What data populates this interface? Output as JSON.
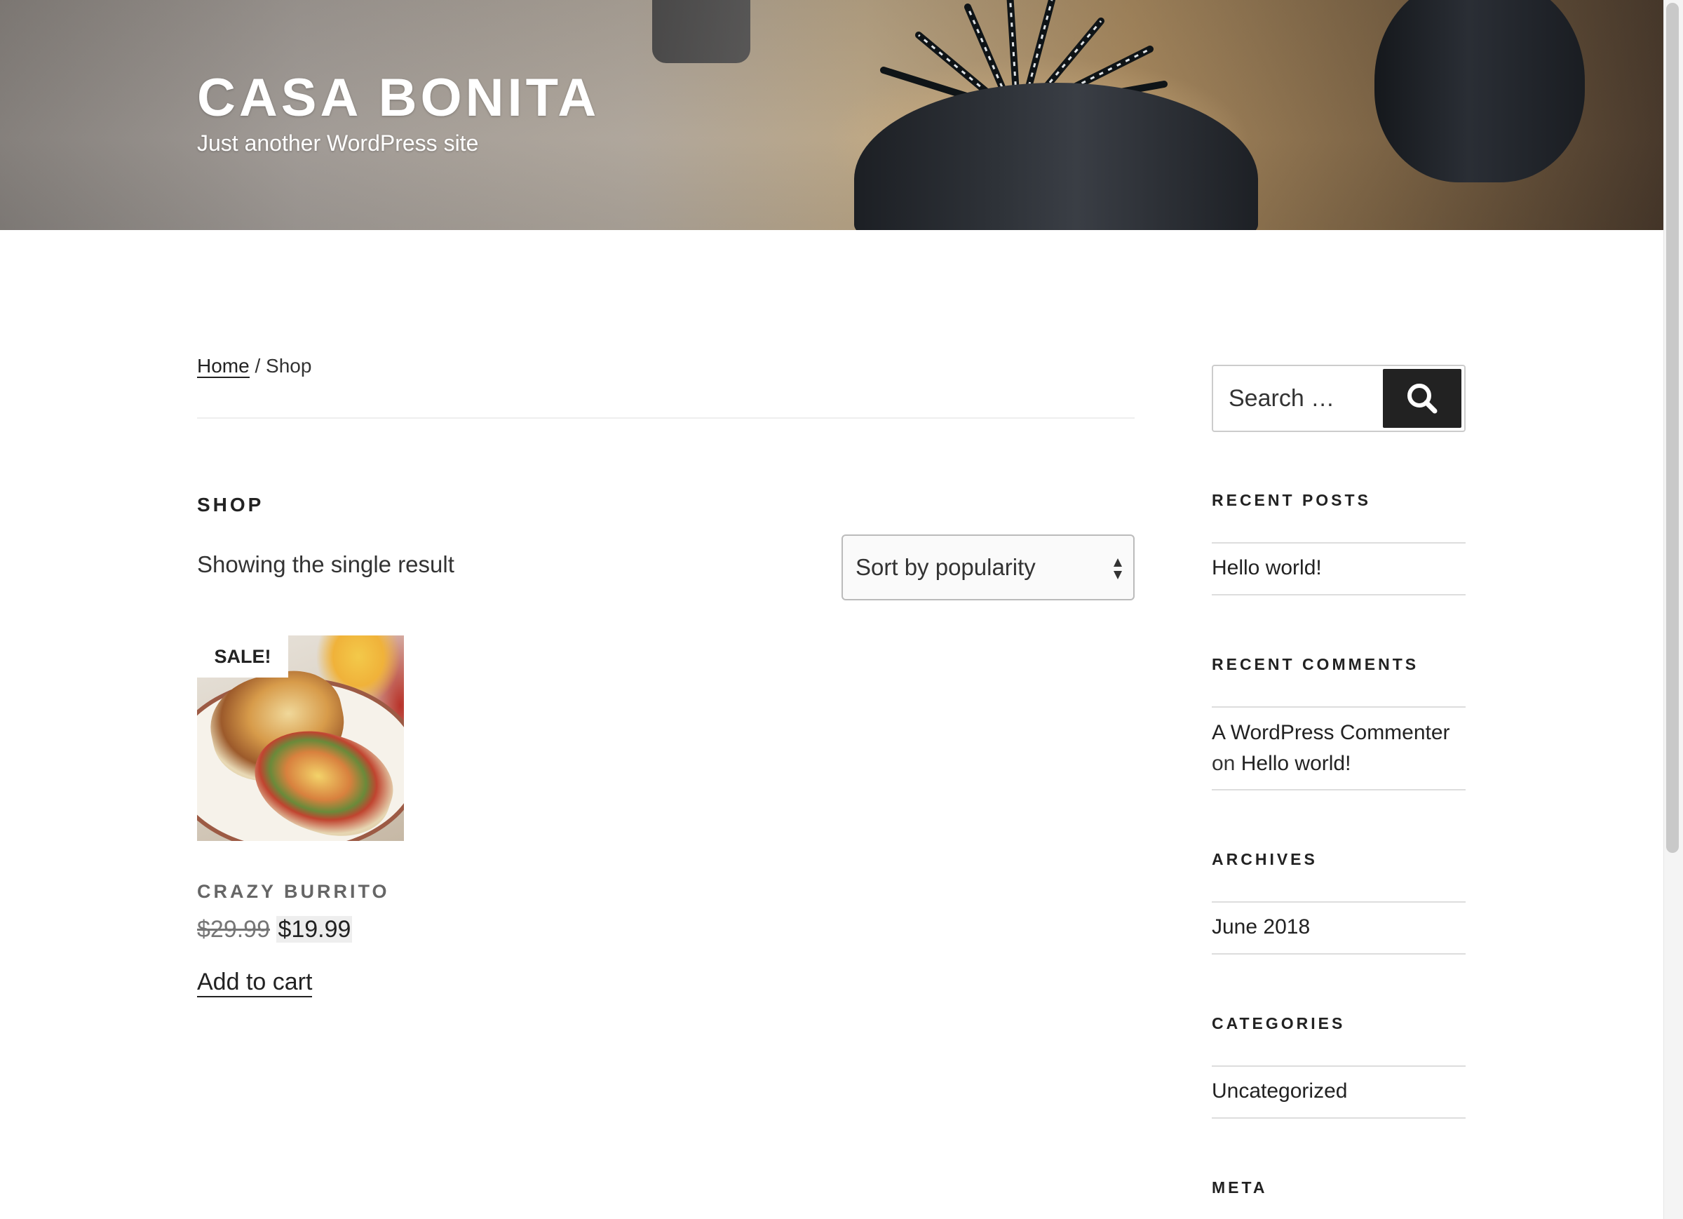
{
  "site": {
    "title": "CASA BONITA",
    "description": "Just another WordPress site"
  },
  "breadcrumb": {
    "home": "Home",
    "separator": " / ",
    "current": "Shop"
  },
  "shop": {
    "title": "SHOP",
    "result_count": "Showing the single result",
    "orderby_selected": "Sort by popularity"
  },
  "product": {
    "badge": "SALE!",
    "name": "CRAZY BURRITO",
    "regular_price": "$29.99",
    "sale_price": "$19.99",
    "add_to_cart": "Add to cart",
    "image_icon": "burrito-photo"
  },
  "sidebar": {
    "search_placeholder": "Search …",
    "search_icon": "search-icon",
    "recent_posts": {
      "title": "RECENT POSTS",
      "items": [
        "Hello world!"
      ]
    },
    "recent_comments": {
      "title": "RECENT COMMENTS",
      "author": "A WordPress Commenter",
      "on": "on",
      "post": "Hello world!"
    },
    "archives": {
      "title": "ARCHIVES",
      "items": [
        "June 2018"
      ]
    },
    "categories": {
      "title": "CATEGORIES",
      "items": [
        "Uncategorized"
      ]
    },
    "meta": {
      "title": "META"
    }
  },
  "colors": {
    "text": "#222222",
    "muted": "#767676",
    "button_bg": "#222222",
    "rule": "#dddddd"
  }
}
